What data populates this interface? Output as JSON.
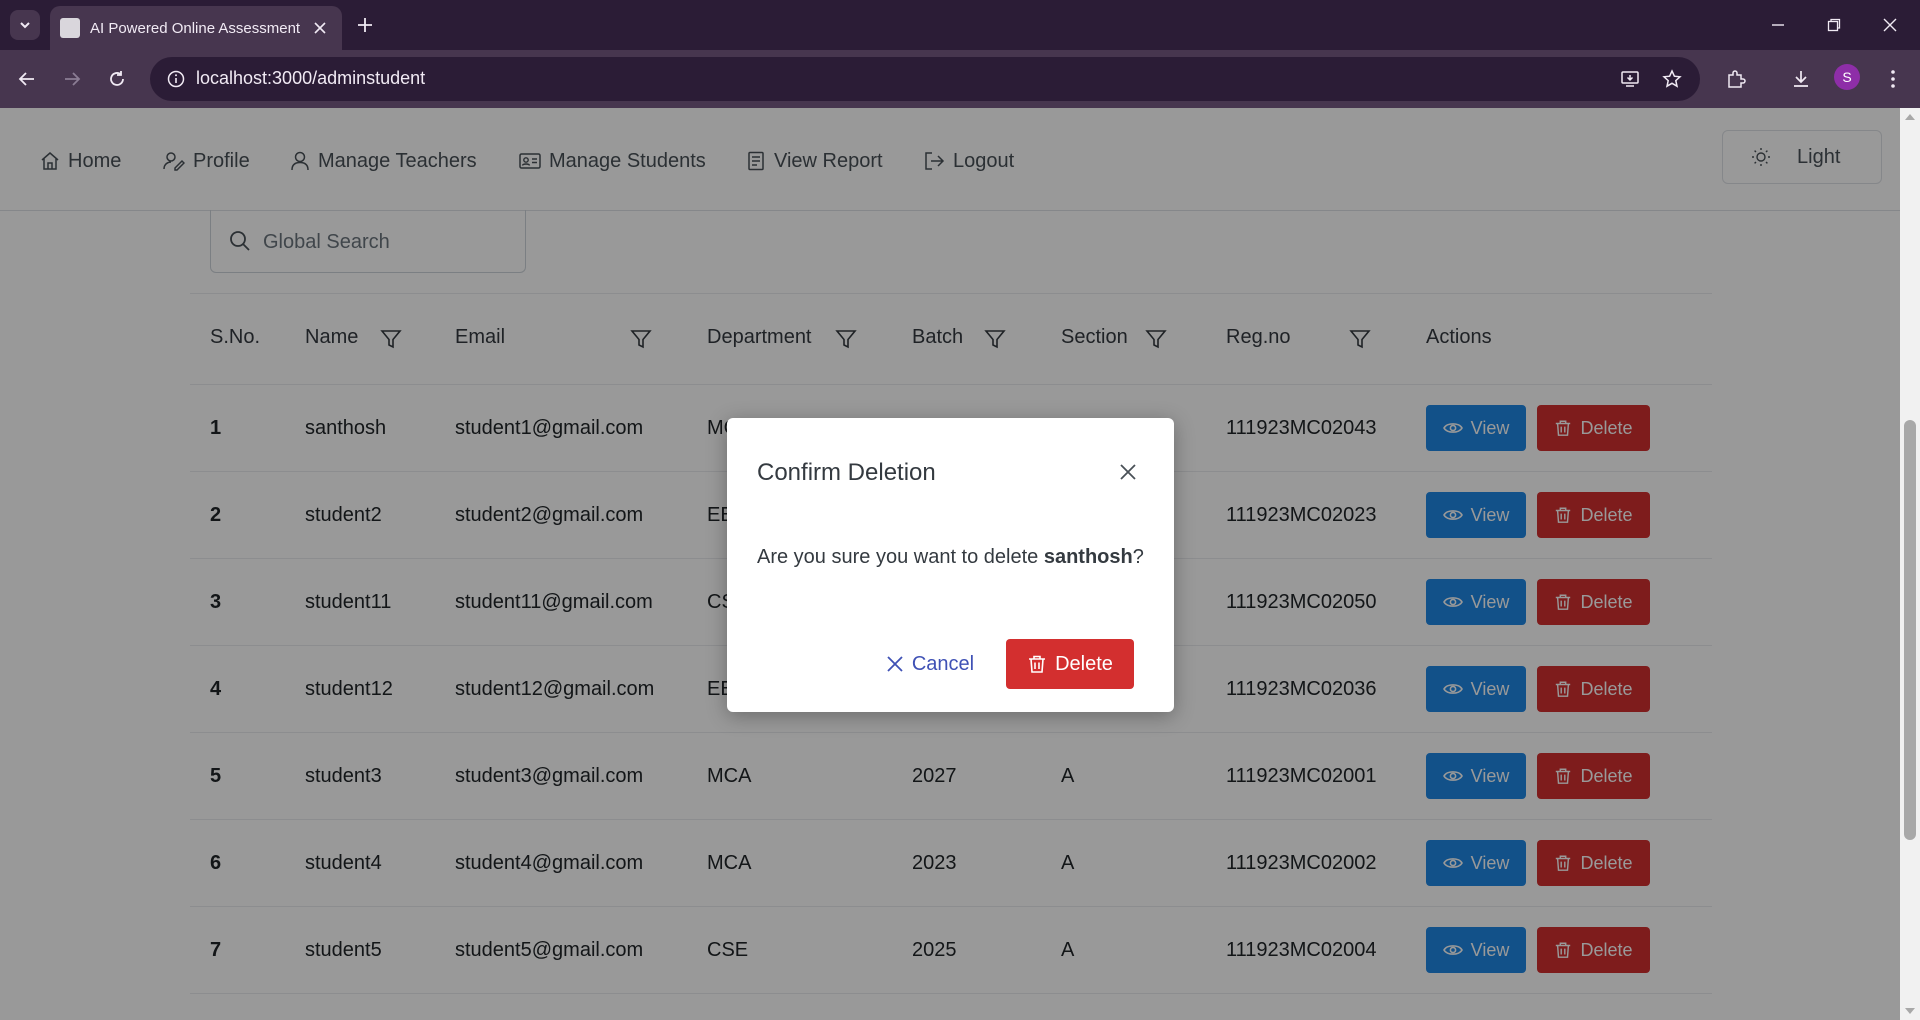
{
  "browser": {
    "tab_title": "AI Powered Online Assessment",
    "url": "localhost:3000/adminstudent",
    "profile_initial": "S"
  },
  "nav": {
    "items": [
      {
        "label": "Home",
        "icon": "home-icon"
      },
      {
        "label": "Profile",
        "icon": "profile-edit-icon"
      },
      {
        "label": "Manage Teachers",
        "icon": "user-icon"
      },
      {
        "label": "Manage Students",
        "icon": "id-card-icon"
      },
      {
        "label": "View Report",
        "icon": "report-icon"
      },
      {
        "label": "Logout",
        "icon": "logout-icon"
      }
    ],
    "theme_label": "Light"
  },
  "search": {
    "placeholder": "Global Search"
  },
  "table": {
    "headers": [
      "S.No.",
      "Name",
      "Email",
      "Department",
      "Batch",
      "Section",
      "Reg.no",
      "Actions"
    ],
    "view_label": "View",
    "delete_label": "Delete",
    "rows": [
      {
        "sno": "1",
        "name": "santhosh",
        "email": "student1@gmail.com",
        "department": "MCA",
        "batch": "",
        "section": "",
        "regno": "111923MC02043"
      },
      {
        "sno": "2",
        "name": "student2",
        "email": "student2@gmail.com",
        "department": "EEE",
        "batch": "",
        "section": "",
        "regno": "111923MC02023"
      },
      {
        "sno": "3",
        "name": "student11",
        "email": "student11@gmail.com",
        "department": "CSE",
        "batch": "",
        "section": "",
        "regno": "111923MC02050"
      },
      {
        "sno": "4",
        "name": "student12",
        "email": "student12@gmail.com",
        "department": "EEE",
        "batch": "",
        "section": "",
        "regno": "111923MC02036"
      },
      {
        "sno": "5",
        "name": "student3",
        "email": "student3@gmail.com",
        "department": "MCA",
        "batch": "2027",
        "section": "A",
        "regno": "111923MC02001"
      },
      {
        "sno": "6",
        "name": "student4",
        "email": "student4@gmail.com",
        "department": "MCA",
        "batch": "2023",
        "section": "A",
        "regno": "111923MC02002"
      },
      {
        "sno": "7",
        "name": "student5",
        "email": "student5@gmail.com",
        "department": "CSE",
        "batch": "2025",
        "section": "A",
        "regno": "111923MC02004"
      }
    ]
  },
  "dialog": {
    "title": "Confirm Deletion",
    "message_prefix": "Are you sure you want to delete ",
    "target_name": "santhosh",
    "message_suffix": "?",
    "cancel_label": "Cancel",
    "delete_label": "Delete"
  },
  "colors": {
    "view_button": "#1e88e5",
    "delete_button": "#d32f2f",
    "cancel_text": "#3f51b5",
    "browser_frame": "#2b1c36",
    "browser_toolbar": "#47364f"
  }
}
